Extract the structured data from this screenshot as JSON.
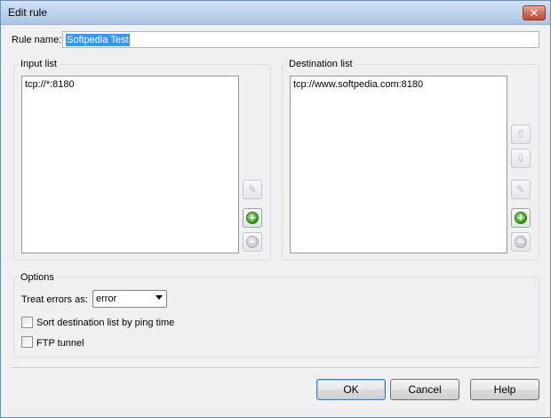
{
  "window": {
    "title": "Edit rule",
    "close_glyph": "✕"
  },
  "rule_name": {
    "label": "Rule name:",
    "value": "Softpedia Test"
  },
  "input_list": {
    "title": "Input list",
    "items": [
      "tcp://*:8180"
    ]
  },
  "destination_list": {
    "title": "Destination list",
    "items": [
      "tcp://www.softpedia.com:8180"
    ]
  },
  "icons": {
    "edit": "edit-icon",
    "add": "add-icon",
    "remove": "remove-icon",
    "move_up": "arrow-up-icon",
    "move_down": "arrow-down-icon",
    "add_glyph": "+",
    "remove_glyph": "−",
    "edit_glyph": "✎",
    "up_glyph": "⇧",
    "down_glyph": "⇩"
  },
  "options": {
    "title": "Options",
    "treat_errors_label": "Treat errors as:",
    "treat_errors_value": "error",
    "sort_label": "Sort destination list by ping time",
    "sort_checked": false,
    "ftp_label": "FTP tunnel",
    "ftp_checked": false
  },
  "buttons": {
    "ok": "OK",
    "cancel": "Cancel",
    "help": "Help"
  },
  "colors": {
    "selection": "#3399ff",
    "add_green": "#2f9a10"
  }
}
